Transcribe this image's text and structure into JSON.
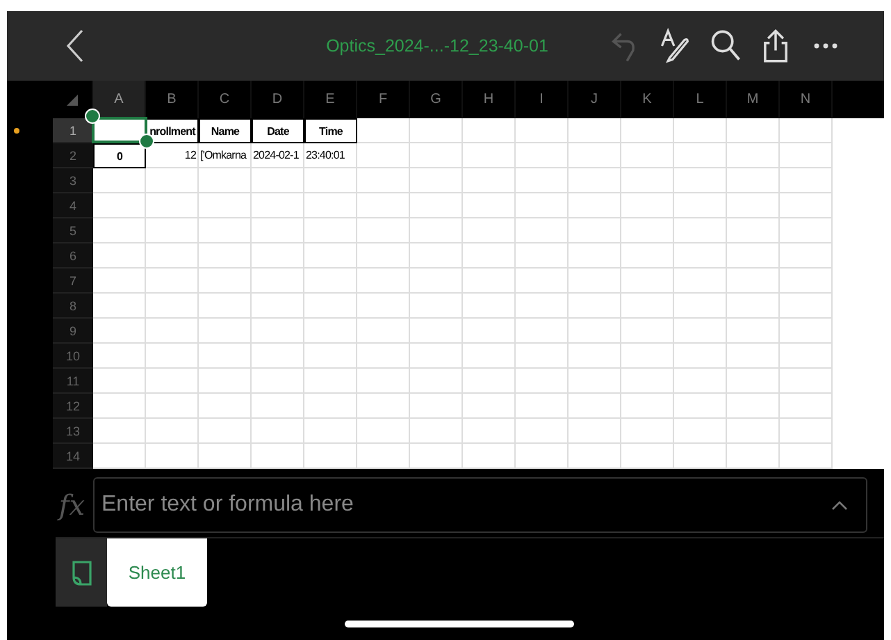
{
  "toolbar": {
    "title": "Optics_2024-...-12_23-40-01",
    "actions": [
      {
        "kind": "undo",
        "disabled": true
      },
      {
        "kind": "draw",
        "disabled": false
      },
      {
        "kind": "search",
        "disabled": false
      },
      {
        "kind": "share",
        "disabled": false
      },
      {
        "kind": "more",
        "disabled": false
      }
    ]
  },
  "columns": [
    {
      "label": "A",
      "selected": true
    },
    {
      "label": "B",
      "selected": false
    },
    {
      "label": "C",
      "selected": false
    },
    {
      "label": "D",
      "selected": false
    },
    {
      "label": "E",
      "selected": false
    },
    {
      "label": "F",
      "selected": false
    },
    {
      "label": "G",
      "selected": false
    },
    {
      "label": "H",
      "selected": false
    },
    {
      "label": "I",
      "selected": false
    },
    {
      "label": "J",
      "selected": false
    },
    {
      "label": "K",
      "selected": false
    },
    {
      "label": "L",
      "selected": false
    },
    {
      "label": "M",
      "selected": false
    },
    {
      "label": "N",
      "selected": false
    }
  ],
  "rows": [
    {
      "label": "1",
      "selected": true,
      "cells": [
        {
          "kind": "header",
          "selected": true
        },
        {
          "kind": "header",
          "text": "nrollment",
          "selected": false
        },
        {
          "kind": "header",
          "text": "Name",
          "selected": false
        },
        {
          "kind": "header",
          "text": "Date",
          "selected": false
        },
        {
          "kind": "header",
          "text": "Time",
          "selected": false
        }
      ]
    },
    {
      "label": "2",
      "selected": false,
      "cells": [
        {
          "kind": "header",
          "text": "0",
          "selected": false
        },
        {
          "kind": "number",
          "text": "12",
          "selected": false
        },
        {
          "kind": "text",
          "text": "['Omkarna",
          "selected": false
        },
        {
          "kind": "text",
          "text": "2024-02-1",
          "selected": false
        },
        {
          "kind": "text",
          "text": "23:40:01",
          "selected": false
        }
      ]
    },
    {
      "label": "3",
      "selected": false,
      "cells": []
    },
    {
      "label": "4",
      "selected": false,
      "cells": []
    },
    {
      "label": "5",
      "selected": false,
      "cells": []
    },
    {
      "label": "6",
      "selected": false,
      "cells": []
    },
    {
      "label": "7",
      "selected": false,
      "cells": []
    },
    {
      "label": "8",
      "selected": false,
      "cells": []
    },
    {
      "label": "9",
      "selected": false,
      "cells": []
    },
    {
      "label": "10",
      "selected": false,
      "cells": []
    },
    {
      "label": "11",
      "selected": false,
      "cells": []
    },
    {
      "label": "12",
      "selected": false,
      "cells": []
    },
    {
      "label": "13",
      "selected": false,
      "cells": []
    },
    {
      "label": "14",
      "selected": false,
      "cells": []
    }
  ],
  "formula_bar": {
    "label": "fx",
    "placeholder": "Enter text or formula here"
  },
  "sheets": [
    {
      "label": "Sheet1",
      "selected": true
    }
  ]
}
